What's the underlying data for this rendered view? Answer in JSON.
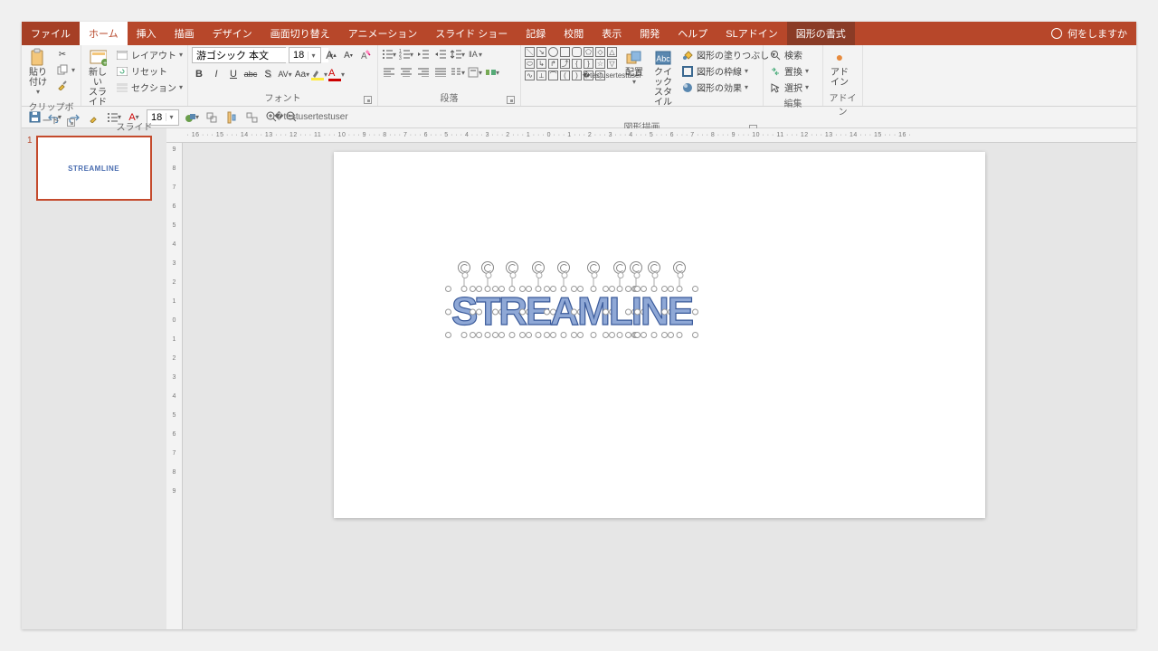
{
  "tabs": {
    "file": "ファイル",
    "home": "ホーム",
    "insert": "挿入",
    "draw": "描画",
    "design": "デザイン",
    "transitions": "画面切り替え",
    "animations": "アニメーション",
    "slideshow": "スライド ショー",
    "record": "記録",
    "review": "校閲",
    "view": "表示",
    "developer": "開発",
    "help": "ヘルプ",
    "sladdin": "SLアドイン",
    "shapeformat": "図形の書式",
    "tell_me": "何をしますか"
  },
  "ribbon": {
    "clipboard": {
      "paste": "貼り付け",
      "label": "クリップボード"
    },
    "slides": {
      "new_slide": "新しい\nスライド",
      "layout": "レイアウト",
      "reset": "リセット",
      "section": "セクション",
      "label": "スライド"
    },
    "font": {
      "name": "游ゴシック 本文",
      "size": "18",
      "label": "フォント"
    },
    "paragraph": {
      "label": "段落"
    },
    "drawing": {
      "arrange": "配置",
      "quick": "クイック\nスタイル",
      "fill": "図形の塗りつぶし",
      "outline": "図形の枠線",
      "effects": "図形の効果",
      "label": "図形描画"
    },
    "editing": {
      "find": "検索",
      "replace": "置換",
      "select": "選択",
      "label": "編集"
    },
    "addins": {
      "addins": "アド\nイン",
      "label": "アドイン"
    }
  },
  "qat": {
    "size": "18"
  },
  "thumb": {
    "num": "1",
    "text": "STREAMLINE"
  },
  "ruler_h": " · 16 · · · 15 · · · 14 · · · 13 · · · 12 · · · 11 · · · 10 · · · 9 · · · 8 · · · 7 · · · 6 · · · 5 · · · 4 · · · 3 · · · 2 · · · 1 · · · 0 · · · 1 · · · 2 · · · 3 · · · 4 · · · 5 · · · 6 · · · 7 · · · 8 · · · 9 · · · 10 · · · 11 · · · 12 · · · 13 · · · 14 · · · 15 · · · 16 · ",
  "ruler_v": [
    "9",
    "8",
    "7",
    "6",
    "5",
    "4",
    "3",
    "2",
    "1",
    "0",
    "1",
    "2",
    "3",
    "4",
    "5",
    "6",
    "7",
    "8",
    "9"
  ],
  "wordart": [
    "S",
    "T",
    "R",
    "E",
    "A",
    "M",
    "L",
    "I",
    "N",
    "E"
  ]
}
